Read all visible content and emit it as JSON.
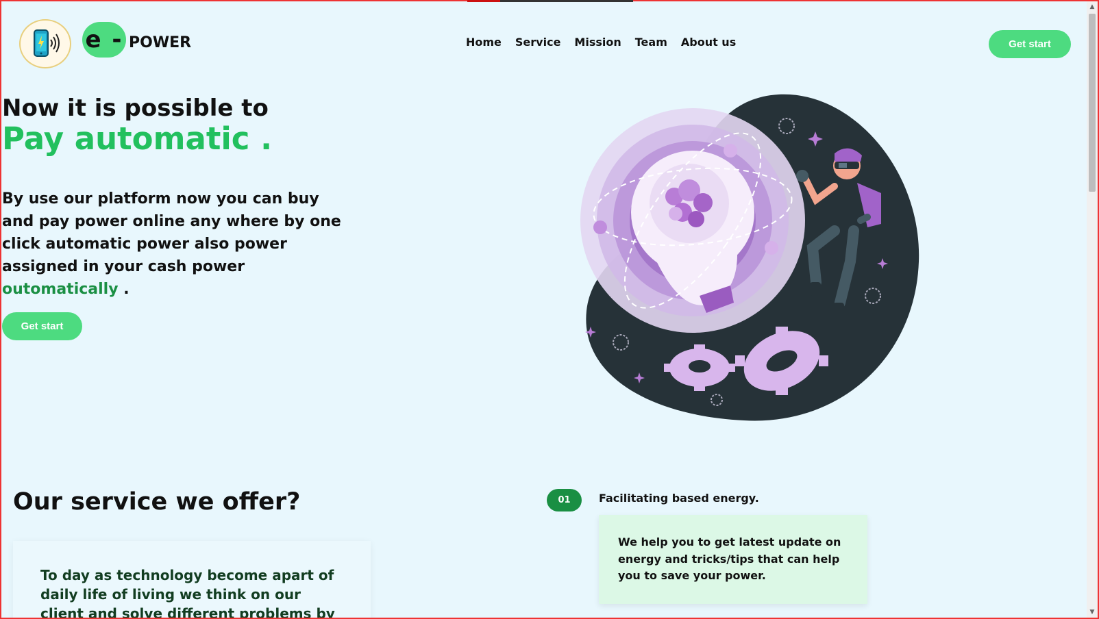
{
  "header": {
    "brand_letter": "e -",
    "brand_name": "POWER",
    "nav": [
      "Home",
      "Service",
      "Mission",
      "Team",
      "About us"
    ],
    "cta_label": "Get start"
  },
  "hero": {
    "line1": "Now it is possible to",
    "line2": "Pay automatic .",
    "paragraph_main": "By use our platform now you can buy and pay power online any where by one click automatic power also power assigned in your cash power",
    "paragraph_accent": "outomatically",
    "paragraph_end": " .",
    "cta_label": "Get start"
  },
  "service": {
    "title": "Our service we offer?",
    "intro": "To day as technology become apart of daily life of living we think on our client and solve different problems by use technology, by",
    "features": [
      {
        "number": "01",
        "title": "Facilitating based energy.",
        "description": "We help you to get latest update on energy and tricks/tips that can help you to save your power."
      }
    ]
  },
  "colors": {
    "accent": "#4ddb80",
    "accent_dark": "#1a8f43",
    "background": "#e8f7fd",
    "feature_card": "#dcf8e6"
  },
  "icons": {
    "logo": "phone-signal-icon",
    "scroll_up": "chevron-up-icon",
    "scroll_down": "chevron-down-icon"
  }
}
